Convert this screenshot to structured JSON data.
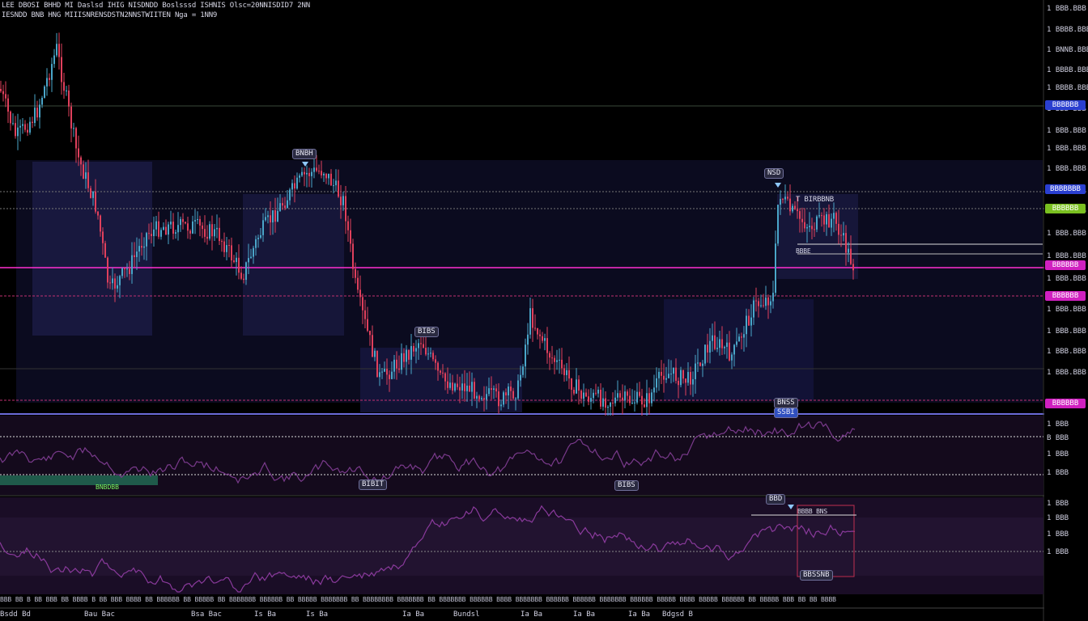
{
  "chart": {
    "legend": {
      "line1": "LEE DBOSI BHHD MI Daslsd IHIG NISDNDD Boslsssd ISHNIS Olsc=20NNISDID7 2NN",
      "line2": "IESNDD BNB HNG MIIISNRENSDSTN2NNSTWIITEN Nga = 1NN9"
    },
    "colors": {
      "background": "#000000",
      "candle_up": "#4aa6c9",
      "candle_down": "#e0405c",
      "zone_fill": "#1e1e4a",
      "magenta_line": "#ff2fd0",
      "pink_line": "#e0408a",
      "blue_tag": "#2a3fd0",
      "green_tag": "#7ac020",
      "magenta_tag": "#d020c0",
      "oscillator": "#7a3a8c"
    },
    "pane_labels": [
      {
        "id": "top-left-peak",
        "text": "BNBH"
      },
      {
        "id": "mid-peak",
        "text": "NSD"
      },
      {
        "id": "low-swing",
        "text": "BIBS"
      },
      {
        "id": "separator-tag",
        "text": "BNSS"
      },
      {
        "id": "separator-tag-2",
        "text": "SSBI"
      },
      {
        "id": "osc-low-1",
        "text": "BIBIT"
      },
      {
        "id": "osc-low-2",
        "text": "BIBS"
      },
      {
        "id": "osc2-marker",
        "text": "BBD"
      },
      {
        "id": "osc2-bottom",
        "text": "BBSSNB"
      }
    ],
    "annotation_text": {
      "right_cluster_title": "T BIRBBNB",
      "right_cluster_sub": "BBBE",
      "osc2_note": "BBBB BNS",
      "ind_green_label": "BNBDBB"
    },
    "price_axis": [
      "1 BBB.BBB",
      "1 BBBB.BBB",
      "1 BNNB.BBB",
      "1 BBBB.BBB",
      "1 BBBB.BBB",
      "1 BBB BBB",
      "1 BBB.BBB",
      "1 BBB.BBB",
      "1 BBB.BBB",
      "1 BBB.BBB",
      "1 BBB.BBB",
      "1 BBB.BBB",
      "1 BBB.BBB",
      "1 BBB.BBB",
      "1 BBB.BBB",
      "1 BBB.BBB",
      "1 BBB.BBB",
      "1 BBB.BBB"
    ],
    "axis_tags": [
      {
        "text": "BBBBBB",
        "color_key": "blue_tag"
      },
      {
        "text": "BBBBBBB",
        "color_key": "blue_tag"
      },
      {
        "text": "BBBBBB",
        "color_key": "green_tag"
      },
      {
        "text": "BBBBBB",
        "color_key": "magenta_tag"
      },
      {
        "text": "BBBBBB",
        "color_key": "magenta_tag"
      },
      {
        "text": "BBBBBB",
        "color_key": "magenta_tag"
      }
    ],
    "osc_axis": [
      "1 BBB",
      "B BBB",
      "1 BBB",
      "1 BBB",
      "1 BBB",
      "1 BBB",
      "1 BBB",
      "1 BBB"
    ],
    "time_labels": [
      "Bsdd Bd",
      "Bau Bac",
      "Bsa Bac",
      "Is Ba",
      "Is Ba",
      "Ia Ba",
      "Bundsl",
      "Ia Ba",
      "Ia Ba",
      "Ia Ba",
      "Bdgsd B"
    ],
    "ticker_text": "BBB BB B BB BBB BB BBBB B BB BBB BBBB BB BBBBBB BB BBBBB BB BBBBBBB BBBBBB BB BBBBB BBBBBBB BB BBBBBBBB BBBBBBB BB BBBBBBB BBBBBB BBBB BBBBBBB BBBBBB BBBBBB BBBBBBB BBBBBB BBBBB BBBB BBBBB BBBBBB BB BBBBB BBB BB BB BBBB"
  }
}
